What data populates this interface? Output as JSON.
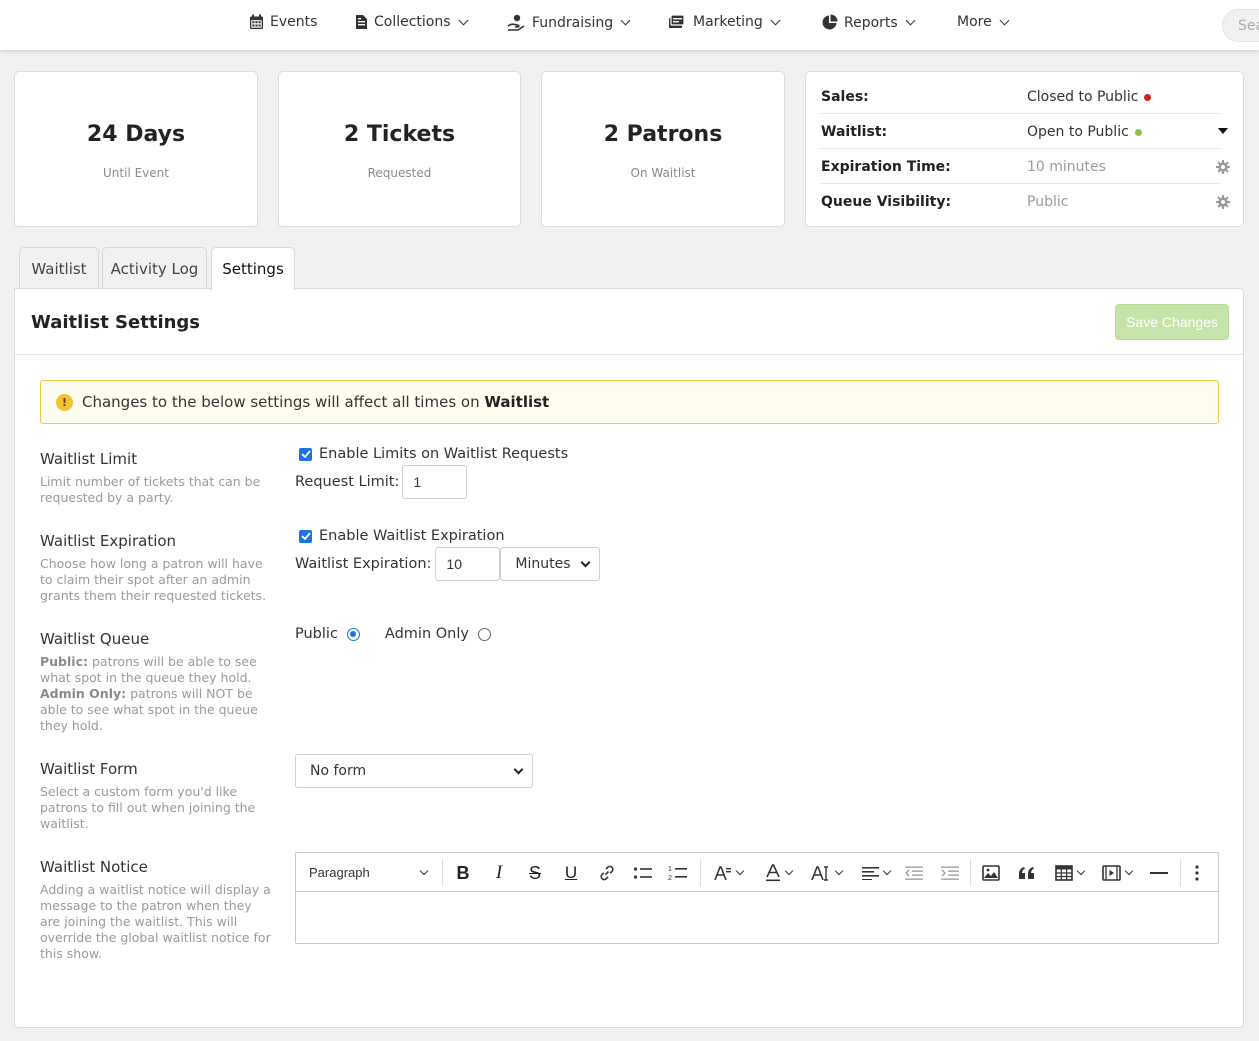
{
  "nav": {
    "items": [
      {
        "label": "Events",
        "icon": "calendar-icon",
        "has_dropdown": false
      },
      {
        "label": "Collections",
        "icon": "file-icon",
        "has_dropdown": true
      },
      {
        "label": "Fundraising",
        "icon": "hand-coin-icon",
        "has_dropdown": true
      },
      {
        "label": "Marketing",
        "icon": "megaphone-icon",
        "has_dropdown": true
      },
      {
        "label": "Reports",
        "icon": "pie-chart-icon",
        "has_dropdown": true
      },
      {
        "label": "More",
        "icon": "",
        "has_dropdown": true
      }
    ],
    "search_placeholder": "Search"
  },
  "stats": [
    {
      "value": "24 Days",
      "label": "Until Event"
    },
    {
      "value": "2 Tickets",
      "label": "Requested"
    },
    {
      "value": "2 Patrons",
      "label": "On Waitlist"
    }
  ],
  "status": {
    "sales": {
      "label": "Sales:",
      "value": "Closed to Public",
      "dot_color": "#cc1f1f"
    },
    "waitlist": {
      "label": "Waitlist:",
      "value": "Open to Public",
      "dot_color": "#8bc34a"
    },
    "expiration": {
      "label": "Expiration Time:",
      "value": "10 minutes"
    },
    "visibility": {
      "label": "Queue Visibility:",
      "value": "Public"
    }
  },
  "tabs": [
    {
      "label": "Waitlist",
      "active": false
    },
    {
      "label": "Activity Log",
      "active": false
    },
    {
      "label": "Settings",
      "active": true
    }
  ],
  "panel": {
    "title": "Waitlist Settings",
    "save_label": "Save Changes",
    "alert_prefix": "Changes to the below settings will affect all times on",
    "alert_target": "Waitlist"
  },
  "limit": {
    "title": "Waitlist Limit",
    "desc": "Limit number of tickets that can be requested by a party.",
    "checkbox_label": "Enable Limits on Waitlist Requests",
    "checked": true,
    "field_label": "Request Limit:",
    "value": "1"
  },
  "expiration": {
    "title": "Waitlist Expiration",
    "desc": "Choose how long a patron will have to claim their spot after an admin grants them their requested tickets.",
    "checkbox_label": "Enable Waitlist Expiration",
    "checked": true,
    "field_label": "Waitlist Expiration:",
    "value": "10",
    "unit": "Minutes"
  },
  "queue": {
    "title": "Waitlist Queue",
    "public_term": "Public:",
    "public_desc": "patrons will be able to see what spot in the queue they hold.",
    "admin_term": "Admin Only:",
    "admin_desc": "patrons will NOT be able to see what spot in the queue they hold.",
    "option_public": "Public",
    "option_admin": "Admin Only",
    "selected": "Public"
  },
  "form": {
    "title": "Waitlist Form",
    "desc": "Select a custom form you'd like patrons to fill out when joining the waitlist.",
    "selected": "No form"
  },
  "notice": {
    "title": "Waitlist Notice",
    "desc": "Adding a waitlist notice will display a message to the patron when they are joining the waitlist. This will override the global waitlist notice for this show.",
    "paragraph_style": "Paragraph",
    "bold_glyph": "B",
    "italic_glyph": "I",
    "strike_glyph": "S",
    "underline_glyph": "U"
  }
}
